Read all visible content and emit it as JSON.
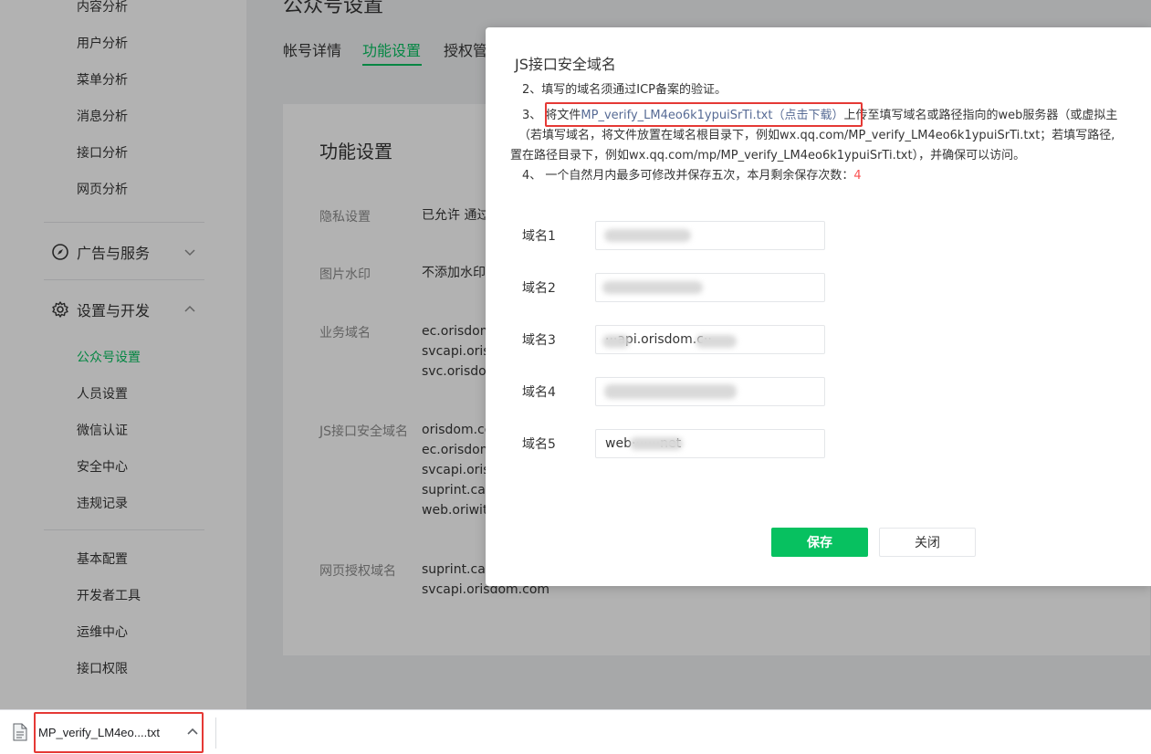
{
  "sidebar": {
    "items_top": [
      {
        "label": "内容分析"
      },
      {
        "label": "用户分析"
      },
      {
        "label": "菜单分析"
      },
      {
        "label": "消息分析"
      },
      {
        "label": "接口分析"
      },
      {
        "label": "网页分析"
      }
    ],
    "group_ads": {
      "label": "广告与服务",
      "icon": "compass-icon"
    },
    "group_settings": {
      "label": "设置与开发",
      "icon": "gear-icon"
    },
    "items_settings": [
      {
        "label": "公众号设置",
        "active": true
      },
      {
        "label": "人员设置"
      },
      {
        "label": "微信认证"
      },
      {
        "label": "安全中心"
      },
      {
        "label": "违规记录"
      }
    ],
    "items_dev": [
      {
        "label": "基本配置"
      },
      {
        "label": "开发者工具"
      },
      {
        "label": "运维中心"
      },
      {
        "label": "接口权限"
      }
    ]
  },
  "main": {
    "title": "公众号设置",
    "tabs": [
      {
        "label": "帐号详情"
      },
      {
        "label": "功能设置",
        "active": true
      },
      {
        "label": "授权管"
      }
    ],
    "card_title": "功能设置",
    "rows": {
      "privacy": {
        "label": "隐私设置",
        "value": "已允许 通过"
      },
      "watermark": {
        "label": "图片水印",
        "value": "不添加水印"
      },
      "business": {
        "label": "业务域名",
        "values": [
          "ec.orisdom",
          "svcapi.oris",
          "svc.orisdor"
        ]
      },
      "js": {
        "label": "JS接口安全域名",
        "values": [
          "orisdom.co",
          "ec.orisdom",
          "svcapi.oris",
          "suprint.car",
          "web.oriwit"
        ]
      },
      "oauth": {
        "label": "网页授权域名",
        "values": [
          "suprint.car",
          "svcapi.orisdom.com"
        ]
      }
    }
  },
  "dialog": {
    "title": "JS接口安全域名",
    "note2": "2、填写的域名须通过ICP备案的验证。",
    "note3_prefix": "3、 将文件",
    "note3_link": "MP_verify_LM4eo6k1ypuiSrTi.txt（点击下载）",
    "note3_suffix": "上传至填写域名或路径指向的web服务器（或虚拟主",
    "note3_line2": "（若填写域名，将文件放置在域名根目录下，例如wx.qq.com/MP_verify_LM4eo6k1ypuiSrTi.txt；若填写路径,",
    "note3_line3": "置在路径目录下，例如wx.qq.com/mp/MP_verify_LM4eo6k1ypuiSrTi.txt），并确保可以访问。",
    "note4_prefix": "4、 一个自然月内最多可修改并保存五次，本月剩余保存次数：",
    "note4_count": "4",
    "domains": [
      {
        "label": "域名1",
        "value": ""
      },
      {
        "label": "域名2",
        "value": ""
      },
      {
        "label": "域名3",
        "value": "···api.orisdom.c··"
      },
      {
        "label": "域名4",
        "value": ""
      },
      {
        "label": "域名5",
        "value": "web·······net"
      }
    ],
    "save_label": "保存",
    "close_label": "关闭"
  },
  "download_bar": {
    "file_name": "MP_verify_LM4eo....txt",
    "file_icon": "text-file-icon"
  },
  "colors": {
    "accent": "#07c160",
    "link": "#576b95",
    "highlight": "#e53935",
    "count": "#fa5151"
  }
}
